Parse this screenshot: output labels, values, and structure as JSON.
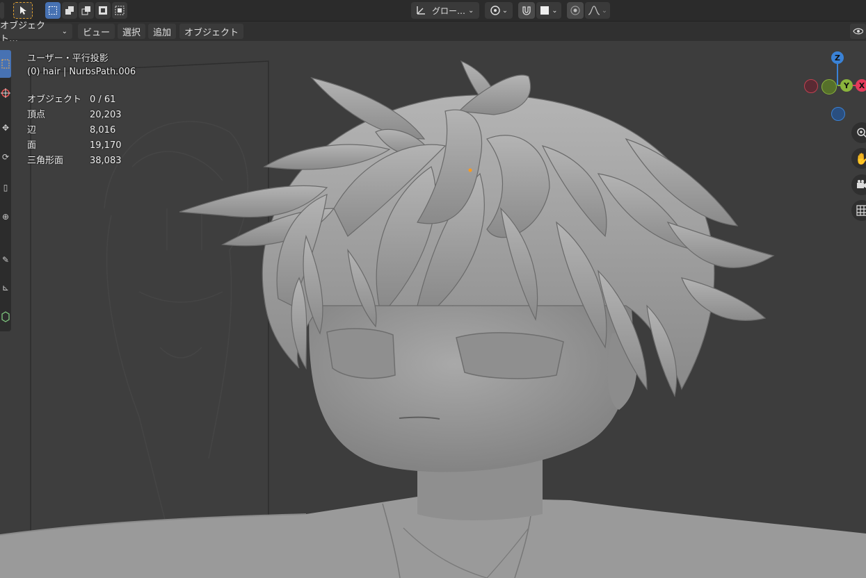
{
  "header": {
    "transform_orientation": "グロー…",
    "mode_select": "オブジェクト…"
  },
  "menu": {
    "items": [
      "ビュー",
      "選択",
      "追加",
      "オブジェクト"
    ]
  },
  "overlay": {
    "view_name": "ユーザー・平行投影",
    "active_object": "(0) hair | NurbsPath.006"
  },
  "stats": [
    {
      "label": "オブジェクト",
      "value": "0 / 61"
    },
    {
      "label": "頂点",
      "value": "20,203"
    },
    {
      "label": "辺",
      "value": "8,016"
    },
    {
      "label": "面",
      "value": "19,170"
    },
    {
      "label": "三角形面",
      "value": "38,083"
    }
  ],
  "gizmo": {
    "z_label": "Z",
    "y_label": "Y",
    "x_label": "X"
  },
  "icons": {
    "select_tool": "cursor-arrow-icon",
    "snap": "magnet-icon",
    "proportional": "proportional-edit-icon"
  },
  "colors": {
    "accent": "#4772b3",
    "axis_x": "#e43a5a",
    "axis_y": "#8ab43c",
    "axis_z": "#3a82d6"
  }
}
